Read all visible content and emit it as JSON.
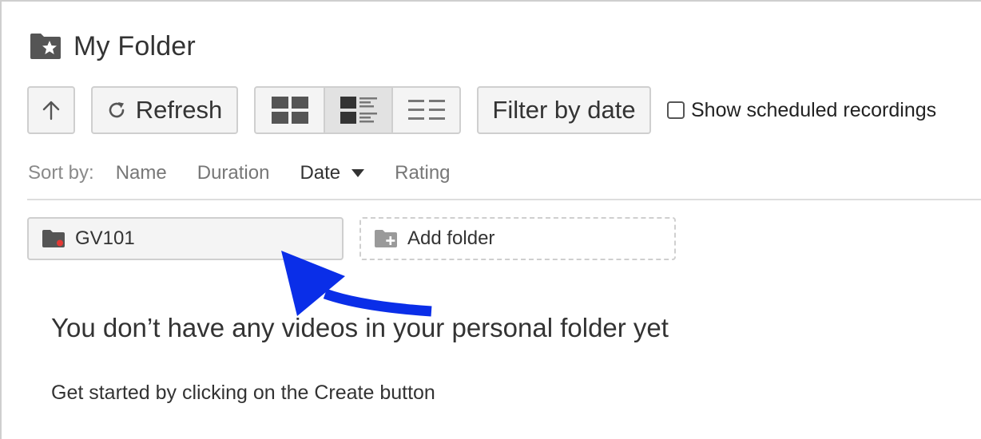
{
  "header": {
    "title": "My Folder",
    "icon": "folder-star-icon"
  },
  "toolbar": {
    "up_icon": "arrow-up-icon",
    "refresh_label": "Refresh",
    "refresh_icon": "refresh-icon",
    "views": [
      {
        "name": "grid-view",
        "icon": "grid-view-icon",
        "active": false
      },
      {
        "name": "detail-list-view",
        "icon": "detail-list-view-icon",
        "active": true
      },
      {
        "name": "list-view",
        "icon": "list-view-icon",
        "active": false
      }
    ],
    "filter_label": "Filter by date",
    "show_scheduled_label": "Show scheduled recordings",
    "show_scheduled_checked": false
  },
  "sort": {
    "label": "Sort by:",
    "options": [
      {
        "label": "Name",
        "active": false
      },
      {
        "label": "Duration",
        "active": false
      },
      {
        "label": "Date",
        "active": true,
        "direction": "descending"
      },
      {
        "label": "Rating",
        "active": false
      }
    ]
  },
  "folders": [
    {
      "name": "GV101",
      "icon": "folder-icon",
      "dot_color": "#e53935"
    }
  ],
  "add_folder": {
    "label": "Add folder",
    "icon": "folder-plus-icon"
  },
  "empty_state": {
    "heading": "You don’t have any videos in your personal folder yet",
    "subtext": "Get started by clicking on the Create button"
  },
  "annotation": {
    "arrow_color": "#0a2ee8"
  },
  "colors": {
    "icon_dark": "#555555",
    "border": "#cfcfcf",
    "button_bg": "#f4f4f4",
    "text": "#333333",
    "muted_text": "#777777"
  }
}
